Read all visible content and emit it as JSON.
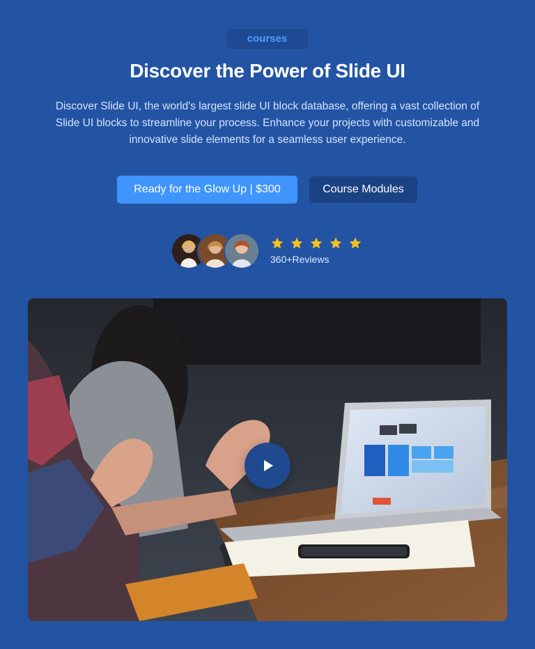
{
  "hero": {
    "badge": "courses",
    "title": "Discover the Power of Slide UI",
    "description": "Discover Slide UI, the world's largest slide UI block database, offering a vast collection of Slide UI blocks to streamline your process. Enhance your projects with customizable and innovative slide elements for a seamless user experience.",
    "primary_button": "Ready for the Glow Up | $300",
    "secondary_button": "Course Modules",
    "reviews": {
      "rating": 5,
      "max_rating": 5,
      "label": "360+Reviews"
    },
    "media": {
      "play_icon": "play-icon",
      "avatar_count": 3
    }
  },
  "colors": {
    "background": "#2354a4",
    "primary_button": "#3f95fb",
    "secondary_button": "#1b4283",
    "badge_text": "#4f9cff",
    "star": "#f7c31a",
    "play_button": "#1f4a8f"
  }
}
